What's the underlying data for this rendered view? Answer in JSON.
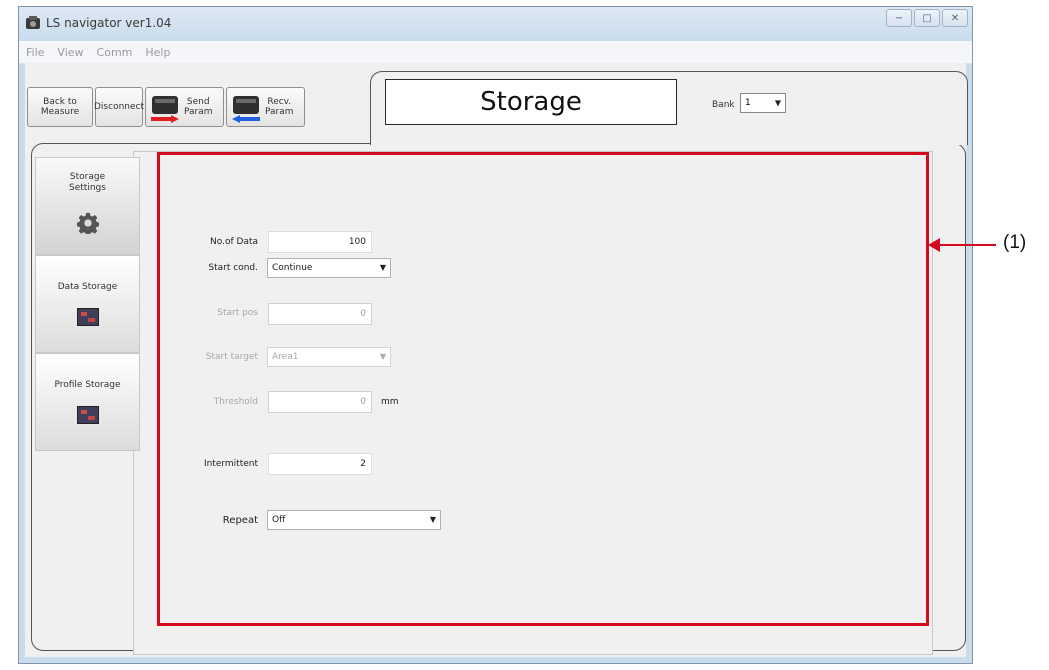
{
  "window": {
    "title": "LS navigator ver1.04",
    "buttons": [
      "−",
      "□",
      "✕"
    ]
  },
  "menu": [
    "File",
    "View",
    "Comm",
    "Help"
  ],
  "toolbar": {
    "back_label": "Back to\nMeasure",
    "disconnect_label": "Disconnect",
    "send_label": "Send\nParam",
    "recv_label": "Recv.\nParam"
  },
  "header": {
    "title": "Storage",
    "bank_label": "Bank",
    "bank_value": "1"
  },
  "nav": [
    {
      "label": "Storage\nSettings",
      "icon": "gear-icon"
    },
    {
      "label": "Data Storage",
      "icon": "chip-icon"
    },
    {
      "label": "Profile Storage",
      "icon": "chip-icon"
    }
  ],
  "form": {
    "no_of_data": {
      "label": "No.of Data",
      "value": "100"
    },
    "start_cond": {
      "label": "Start cond.",
      "value": "Continue"
    },
    "start_pos": {
      "label": "Start pos",
      "value": "0"
    },
    "start_target": {
      "label": "Start target",
      "value": "Area1"
    },
    "threshold": {
      "label": "Threshold",
      "value": "0",
      "unit": "mm"
    },
    "intermittent": {
      "label": "Intermittent",
      "value": "2"
    },
    "repeat": {
      "label": "Repeat",
      "value": "Off"
    }
  },
  "callout": {
    "label": "(1)"
  },
  "colors": {
    "highlight": "#d10a1e",
    "window": "#c9dcec",
    "client": "#f0f0f0"
  }
}
